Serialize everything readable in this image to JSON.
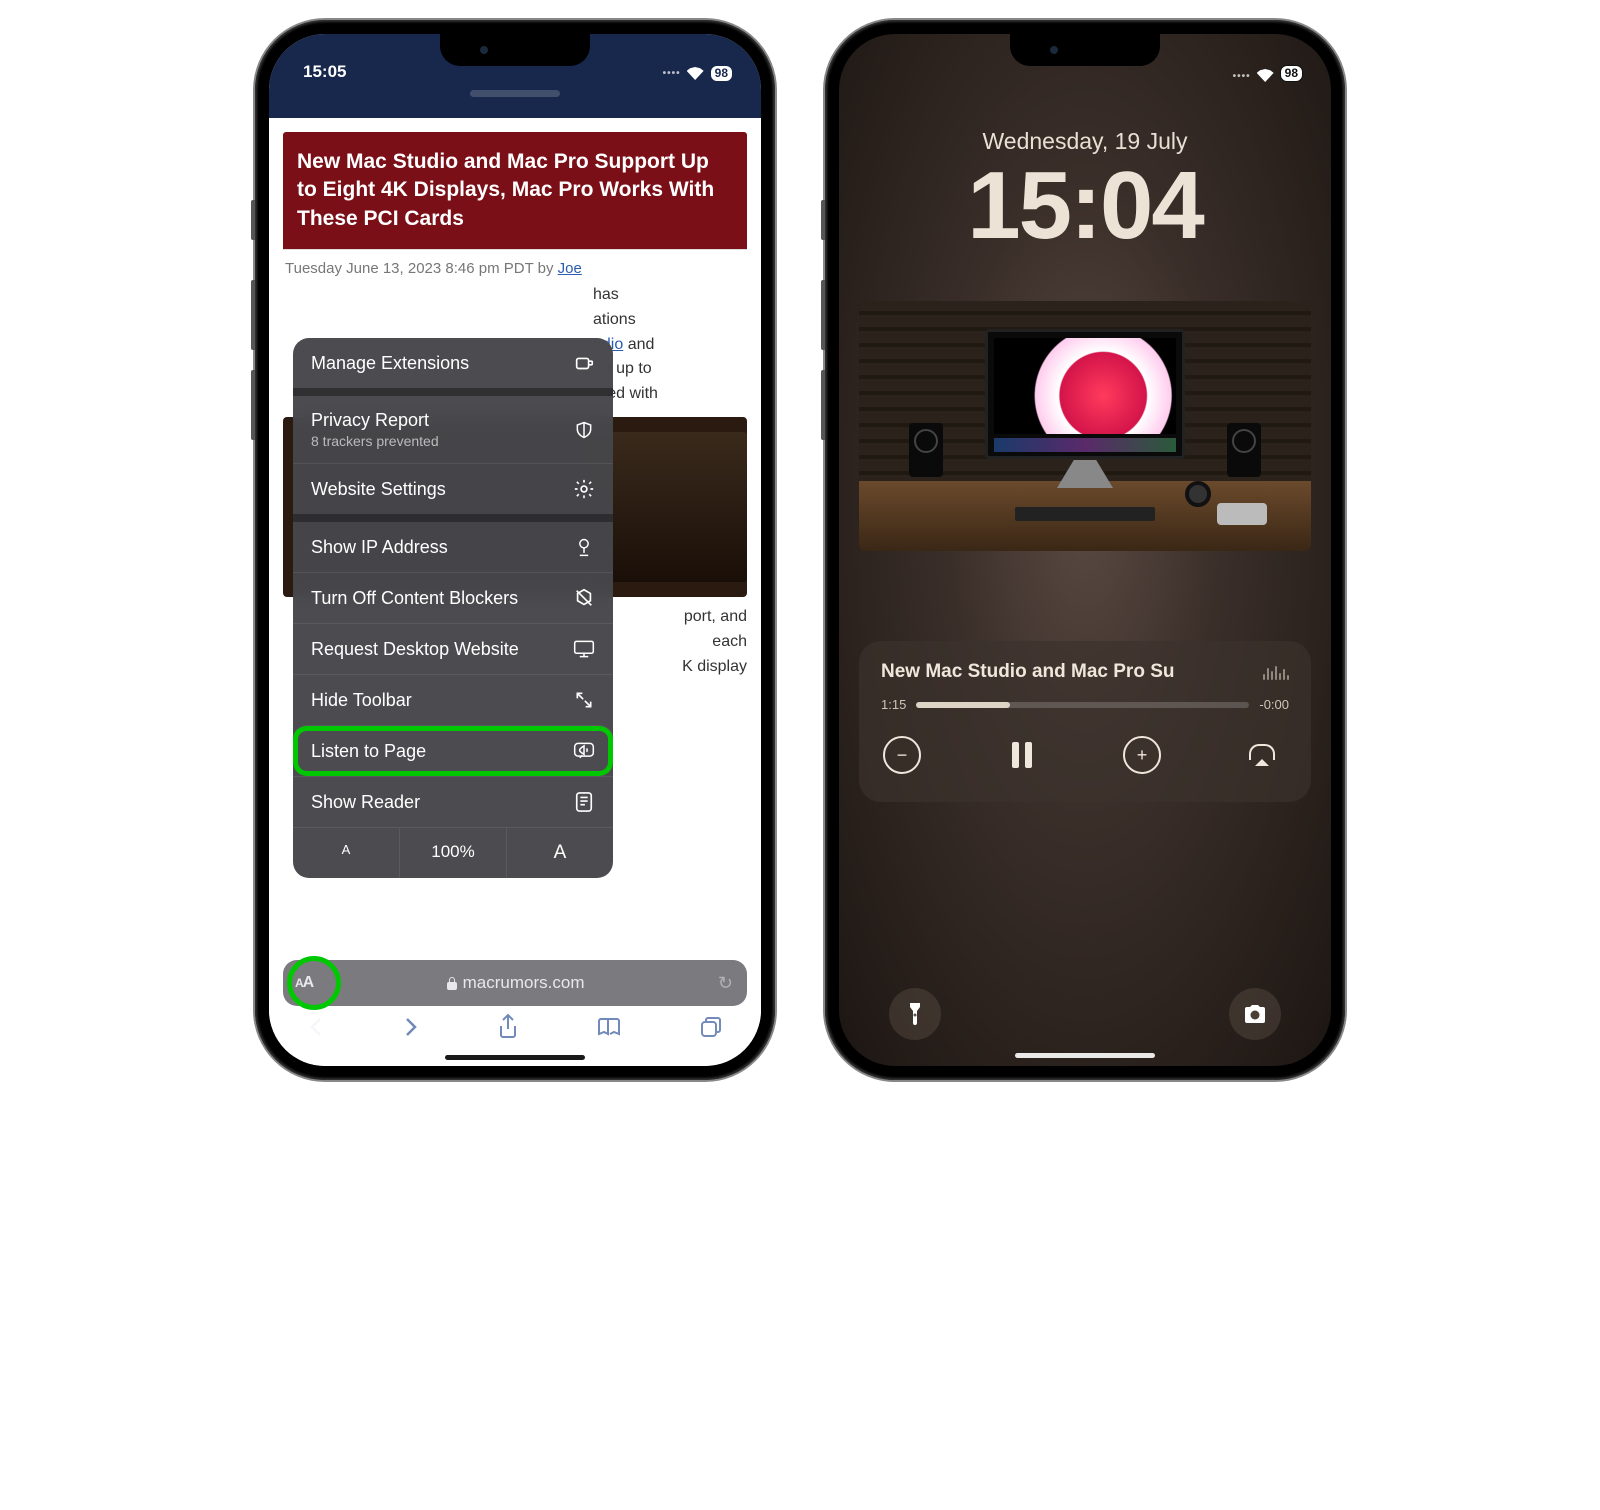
{
  "left": {
    "status": {
      "time": "15:05",
      "battery": "98"
    },
    "article": {
      "title": "New Mac Studio and Mac Pro Support Up to Eight 4K Displays, Mac Pro Works With These PCI Cards",
      "meta_prefix": "Tuesday June 13, 2023 8:46 pm PDT by ",
      "meta_author": "Joe",
      "p1a": " has",
      "p1b": "ations",
      "p1c_link": "udio",
      "p1d": " and",
      "p1e": "ort up to",
      "p1f": "ured with",
      "p2a": "port, and",
      "p2b": " each",
      "p2c": "K display"
    },
    "menu": {
      "manage_ext": "Manage Extensions",
      "privacy": "Privacy Report",
      "privacy_sub": "8 trackers prevented",
      "website_settings": "Website Settings",
      "show_ip": "Show IP Address",
      "content_blockers": "Turn Off Content Blockers",
      "desktop": "Request Desktop Website",
      "hide_toolbar": "Hide Toolbar",
      "listen": "Listen to Page",
      "reader": "Show Reader",
      "zoom_small": "A",
      "zoom_pct": "100%",
      "zoom_big": "A"
    },
    "urlbar": {
      "aa": "AA",
      "domain": "macrumors.com",
      "reload": "↻"
    },
    "toolbar": {
      "back": "‹",
      "fwd": "›",
      "share": "⇪",
      "books": "▭",
      "tabs": "❐"
    }
  },
  "right": {
    "status": {
      "battery": "98"
    },
    "date": "Wednesday, 19 July",
    "time": "15:04",
    "now_playing": {
      "title": "New Mac Studio and Mac Pro Su",
      "elapsed": "1:15",
      "remaining": "-0:00"
    }
  }
}
